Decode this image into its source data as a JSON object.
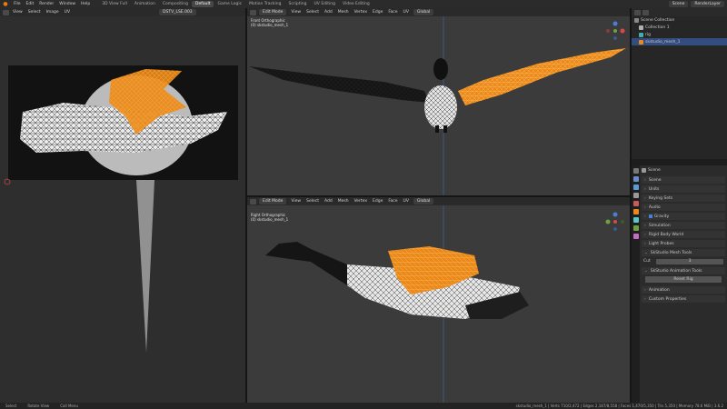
{
  "topbar": {
    "menus": [
      "File",
      "Edit",
      "Render",
      "Window",
      "Help"
    ],
    "workspaces": [
      "3D View Full",
      "Animation",
      "Compositing",
      "Default",
      "Game Logic",
      "Motion Tracking",
      "Scripting",
      "UV Editing",
      "Video Editing"
    ],
    "active_workspace": "Default",
    "scene": "Scene",
    "view_layer": "RenderLayer"
  },
  "image_editor": {
    "header_items": [
      "View",
      "Select",
      "Image",
      "UV"
    ],
    "image_name": "DSTV_LSE.003"
  },
  "viewport_top": {
    "mode": "Edit Mode",
    "menus": [
      "View",
      "Select",
      "Add",
      "Mesh",
      "Vertex",
      "Edge",
      "Face",
      "UV"
    ],
    "transform": "Global",
    "label_line1": "Front Orthographic",
    "label_line2": "(0) skstudio_mesh_1"
  },
  "viewport_bottom": {
    "mode": "Edit Mode",
    "menus": [
      "View",
      "Select",
      "Add",
      "Mesh",
      "Vertex",
      "Edge",
      "Face",
      "UV"
    ],
    "transform": "Global",
    "label_line1": "Right Orthographic",
    "label_line2": "(0) skstudio_mesh_1"
  },
  "outliner": {
    "title": "Scene Collection",
    "rows": [
      {
        "label": "Scene Collection",
        "selected": false
      },
      {
        "label": "Collection 1",
        "selected": false
      },
      {
        "label": "rig",
        "selected": false
      },
      {
        "label": "skstudio_mesh_1",
        "selected": true
      }
    ]
  },
  "properties": {
    "title": "Scene",
    "sections": [
      "Scene",
      "Units",
      "Keying Sets",
      "Audio",
      "Gravity",
      "Simulation",
      "Rigid Body World",
      "Light Probes",
      "SkStudio Mesh Tools"
    ],
    "field_label": "Cut",
    "field_value": "3",
    "anim_tools_title": "SkStudio Animation Tools",
    "reset_button": "Reset Rig",
    "bottom_sections": [
      "Animation",
      "Custom Properties"
    ]
  },
  "statusbar": {
    "select": "Select",
    "rotate": "Rotate View",
    "call_menu": "Call Menu",
    "stats": "skstudio_mesh_1 | Verts 710/2,472 | Edges 2,187/8,558 | Faces 1,470/5,350 | Tris 5,350 | Memory 78.6 MiB | 3.6.2"
  },
  "colors": {
    "accent": "#e87d0d",
    "selection": "#334d80",
    "viewport_bg": "#3b3b3b"
  }
}
